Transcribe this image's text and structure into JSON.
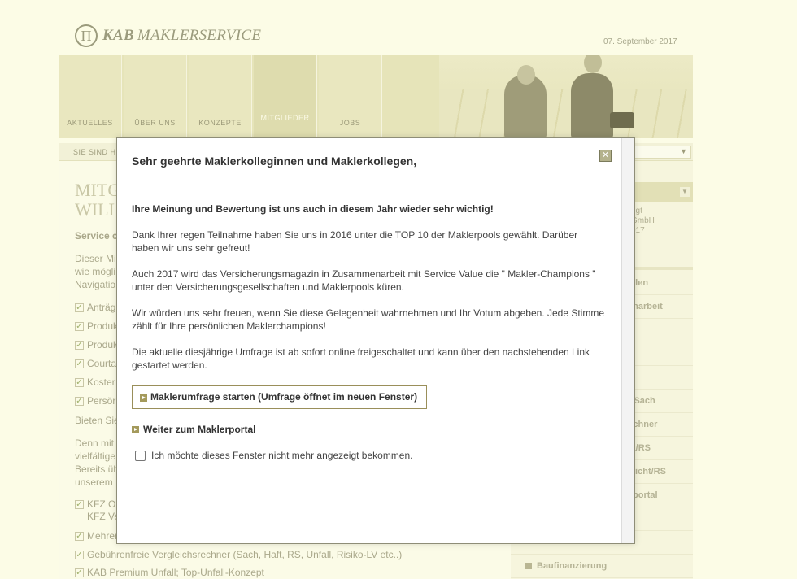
{
  "header": {
    "logo_bold": "KAB",
    "logo_rest": "MAKLERSERVICE",
    "logo_glyph": "Π",
    "date": "07. September 2017"
  },
  "nav": {
    "tabs": [
      "AKTUELLES",
      "ÜBER UNS",
      "KONZEPTE",
      "MITGLIEDER",
      "JOBS"
    ],
    "active": "MITGLIEDER"
  },
  "breadcrumb": {
    "text": "SIE SIND H"
  },
  "main": {
    "title_line1": "MITG",
    "title_line2": "WILL",
    "service_label": "Service c",
    "intro_line1": "Dieser Mi",
    "intro_line2": "wie mögli",
    "intro_line3": "Navigatio",
    "checklist": [
      "Anträg",
      "Produk",
      "Produk",
      "Courta",
      "Koster",
      "Persör"
    ],
    "offer_label": "Bieten Sie",
    "more_line1": "Denn mit",
    "more_line2": "vielfältige",
    "more_line3": "Bereits üb",
    "more_line4": "unserem",
    "checklist2": [
      {
        "line1": "KFZ O",
        "line2": "KFZ Ve"
      },
      {
        "line1": "Mehrer"
      },
      {
        "line1": "Gebührenfreie Vergleichsrechner (Sach, Haft, RS, Unfall, Risiko-LV etc..)"
      },
      {
        "line1": "KAB Premium Unfall; Top-Unfall-Konzept"
      }
    ]
  },
  "sidebar": {
    "info_line1": "ggt",
    "info_line2": "GmbH",
    "info_line3": "017",
    "links": [
      "ellen",
      "enarbeit",
      "er Sach",
      "rechner",
      "t/RS",
      "licht/RS",
      "portal",
      "Baufinanzierung"
    ]
  },
  "modal": {
    "title": "Sehr geehrte Maklerkolleginnen und Maklerkollegen,",
    "lead": "Ihre Meinung und Bewertung ist uns auch in diesem Jahr wieder sehr wichtig!",
    "para1": "Dank Ihrer regen Teilnahme haben Sie uns in 2016 unter die TOP 10 der Maklerpools gewählt. Darüber haben wir uns sehr gefreut!",
    "para2": "Auch 2017 wird das Versicherungsmagazin in Zusammenarbeit mit Service Value die \" Makler-Champions \" unter den Versicherungsgesellschaften und Maklerpools küren.",
    "para3": "Wir würden uns sehr freuen, wenn Sie diese Gelegenheit wahrnehmen und Ihr Votum abgeben. Jede Stimme zählt für Ihre persönlichen Maklerchampions!",
    "para4": "Die aktuelle diesjährige Umfrage ist ab sofort online freigeschaltet und kann über den nachstehenden Link gestartet werden.",
    "start_button": "Maklerumfrage starten (Umfrage öffnet im neuen Fenster)",
    "portal_link": "Weiter zum Maklerportal",
    "checkbox_label": "Ich möchte dieses Fenster nicht mehr angezeigt bekommen.",
    "close_glyph": "✕"
  },
  "colors": {
    "page_bg": "#fcfce6",
    "nav_bg": "#e6e4b9",
    "accent": "#a49a5c",
    "modal_border": "#8e8d77"
  }
}
